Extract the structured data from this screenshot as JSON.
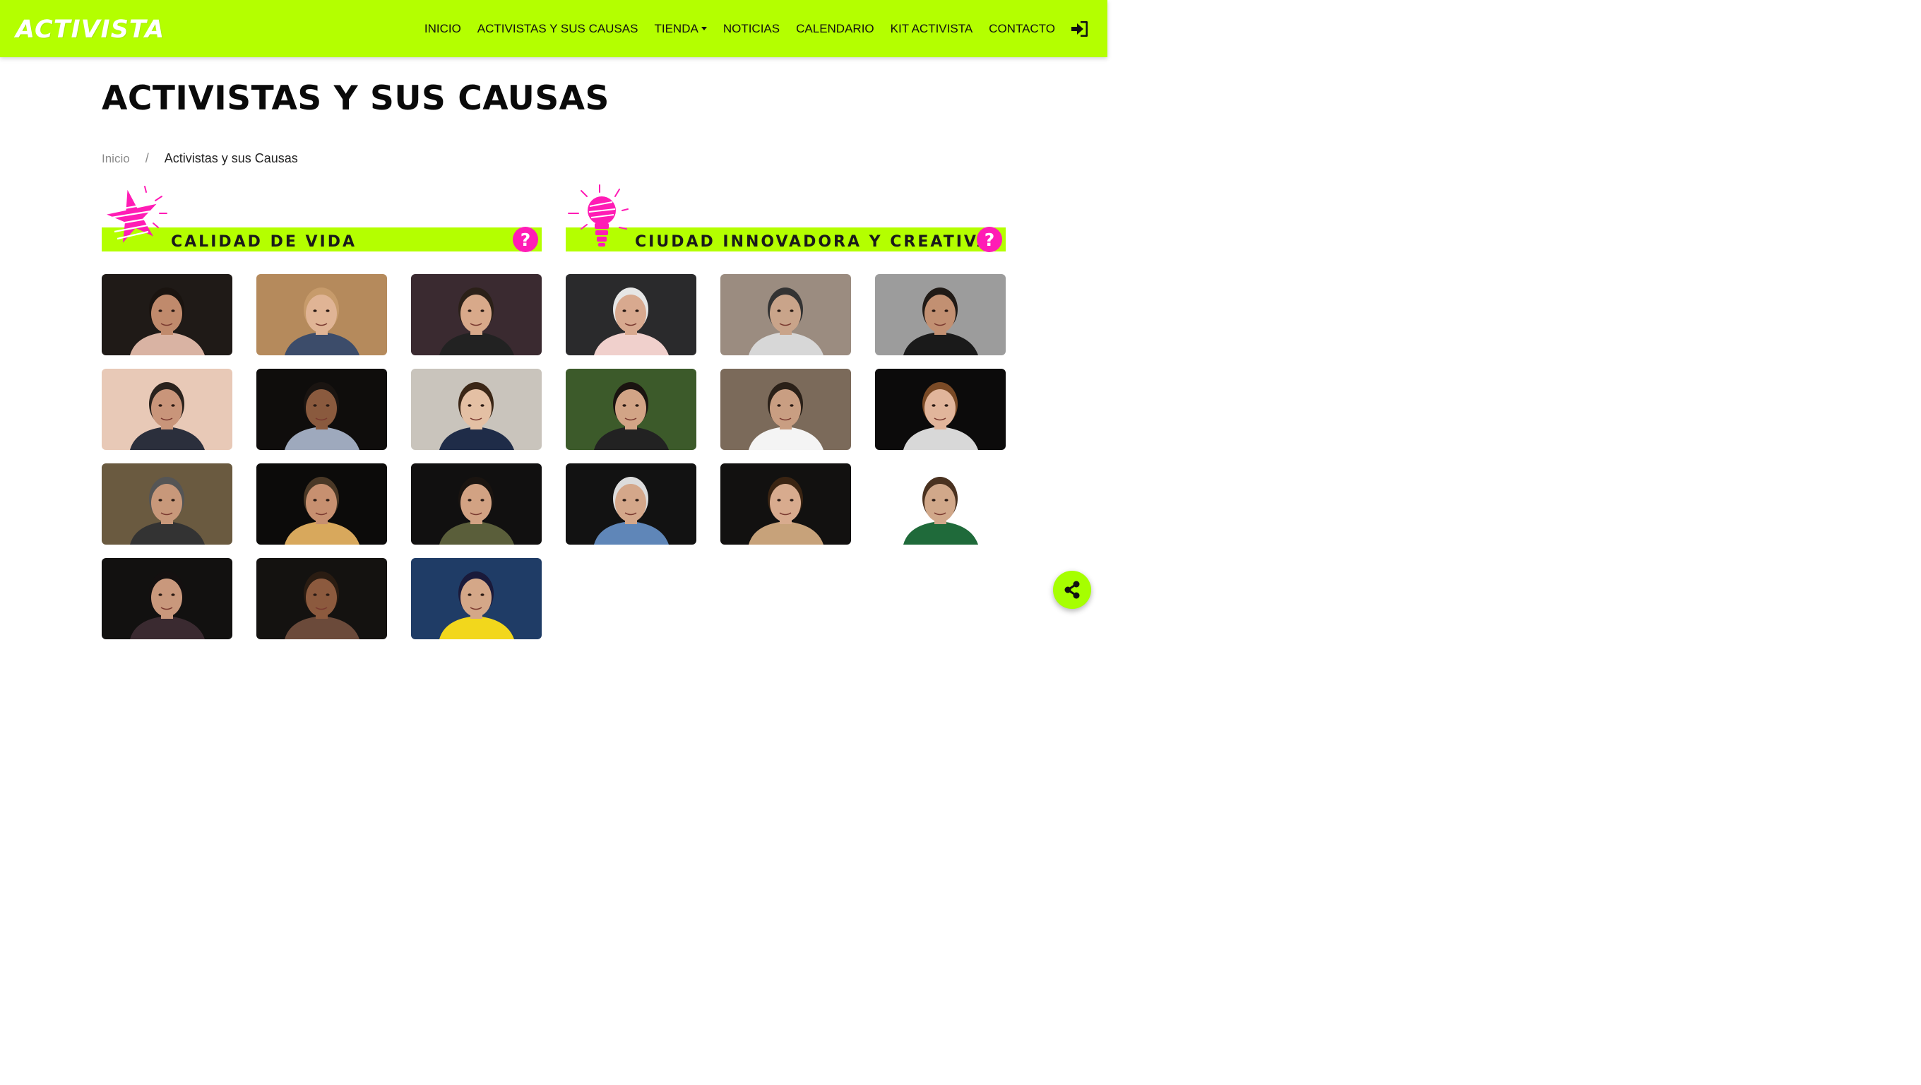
{
  "brand": {
    "name": "ACTIVISTA"
  },
  "nav": {
    "items": [
      {
        "label": "INICIO"
      },
      {
        "label": "ACTIVISTAS Y SUS CAUSAS"
      },
      {
        "label": "TIENDA",
        "dropdown": true
      },
      {
        "label": "NOTICIAS"
      },
      {
        "label": "CALENDARIO"
      },
      {
        "label": "KIT ACTIVISTA"
      },
      {
        "label": "CONTACTO"
      }
    ],
    "login_icon": "sign-in-icon"
  },
  "page": {
    "title": "ACTIVISTAS Y SUS CAUSAS",
    "breadcrumb": {
      "home": "Inicio",
      "separator": "/",
      "current": "Activistas y sus Causas"
    }
  },
  "sections": [
    {
      "label": "CALIDAD DE VIDA",
      "icon": "star-icon",
      "help": "?",
      "cards": [
        {
          "bg": "#1f1a17",
          "skin": "#c08a6c",
          "hair": "#1a1410",
          "cloth": "#d9b3a3"
        },
        {
          "bg": "#b58a5c",
          "skin": "#e0b495",
          "hair": "#c79b6b",
          "cloth": "#3c4c6a"
        },
        {
          "bg": "#3a2a30",
          "skin": "#d8a98a",
          "hair": "#2b2018",
          "cloth": "#222"
        },
        {
          "bg": "#e8c9b7",
          "skin": "#c9957a",
          "hair": "#2a221d",
          "cloth": "#2b2f3c"
        },
        {
          "bg": "#0f0d0c",
          "skin": "#8a5a3e",
          "hair": "#1a1411",
          "cloth": "#9ea9bd"
        },
        {
          "bg": "#c9c4bc",
          "skin": "#e4c0a4",
          "hair": "#3a2616",
          "cloth": "#1f2c48"
        },
        {
          "bg": "#6a5a40",
          "skin": "#c8987a",
          "hair": "#555",
          "cloth": "#333"
        },
        {
          "bg": "#0c0b0a",
          "skin": "#c79070",
          "hair": "#4a3826",
          "cloth": "#d8a85c"
        },
        {
          "bg": "#111010",
          "skin": "#d2a283",
          "hair": "#1a1410",
          "cloth": "#5a5e3a"
        },
        {
          "bg": "#121110",
          "skin": "#c9987c",
          "hair": "#141010",
          "cloth": "#3a2a30"
        },
        {
          "bg": "#141210",
          "skin": "#8c5a3e",
          "hair": "#2a1c12",
          "cloth": "#6b4a3a"
        },
        {
          "bg": "#1f3c66",
          "skin": "#d4a788",
          "hair": "#1a1a3a",
          "cloth": "#f2d71c"
        }
      ]
    },
    {
      "label": "CIUDAD INNOVADORA Y CREATIVA",
      "icon": "lightbulb-icon",
      "help": "?",
      "cards": [
        {
          "bg": "#2a2a2c",
          "skin": "#d8a98f",
          "hair": "#e6e6e6",
          "cloth": "#f0d0cc"
        },
        {
          "bg": "#9b8c80",
          "skin": "#c9a48a",
          "hair": "#333",
          "cloth": "#d7d7d7"
        },
        {
          "bg": "#9c9c9c",
          "skin": "#c29072",
          "hair": "#201a16",
          "cloth": "#1a1a1a"
        },
        {
          "bg": "#3c5a2a",
          "skin": "#d2a486",
          "hair": "#1a1410",
          "cloth": "#222"
        },
        {
          "bg": "#7b6a5a",
          "skin": "#c99e82",
          "hair": "#2a2018",
          "cloth": "#f4f4f4"
        },
        {
          "bg": "#0c0b0b",
          "skin": "#e1b59b",
          "hair": "#7a4a26",
          "cloth": "#d8d8d8"
        },
        {
          "bg": "#121212",
          "skin": "#d4a78a",
          "hair": "#dcdcdc",
          "cloth": "#5f86b8"
        },
        {
          "bg": "#121110",
          "skin": "#d8ab8e",
          "hair": "#3a2412",
          "cloth": "#c7a27a"
        },
        {
          "bg": "#ffffff",
          "skin": "#d1a88a",
          "hair": "#4a3220",
          "cloth": "#1f6a3a"
        }
      ]
    }
  ],
  "fab": {
    "icon": "share-icon"
  },
  "colors": {
    "accent": "#b4ff00",
    "pink": "#ff1cb5"
  }
}
